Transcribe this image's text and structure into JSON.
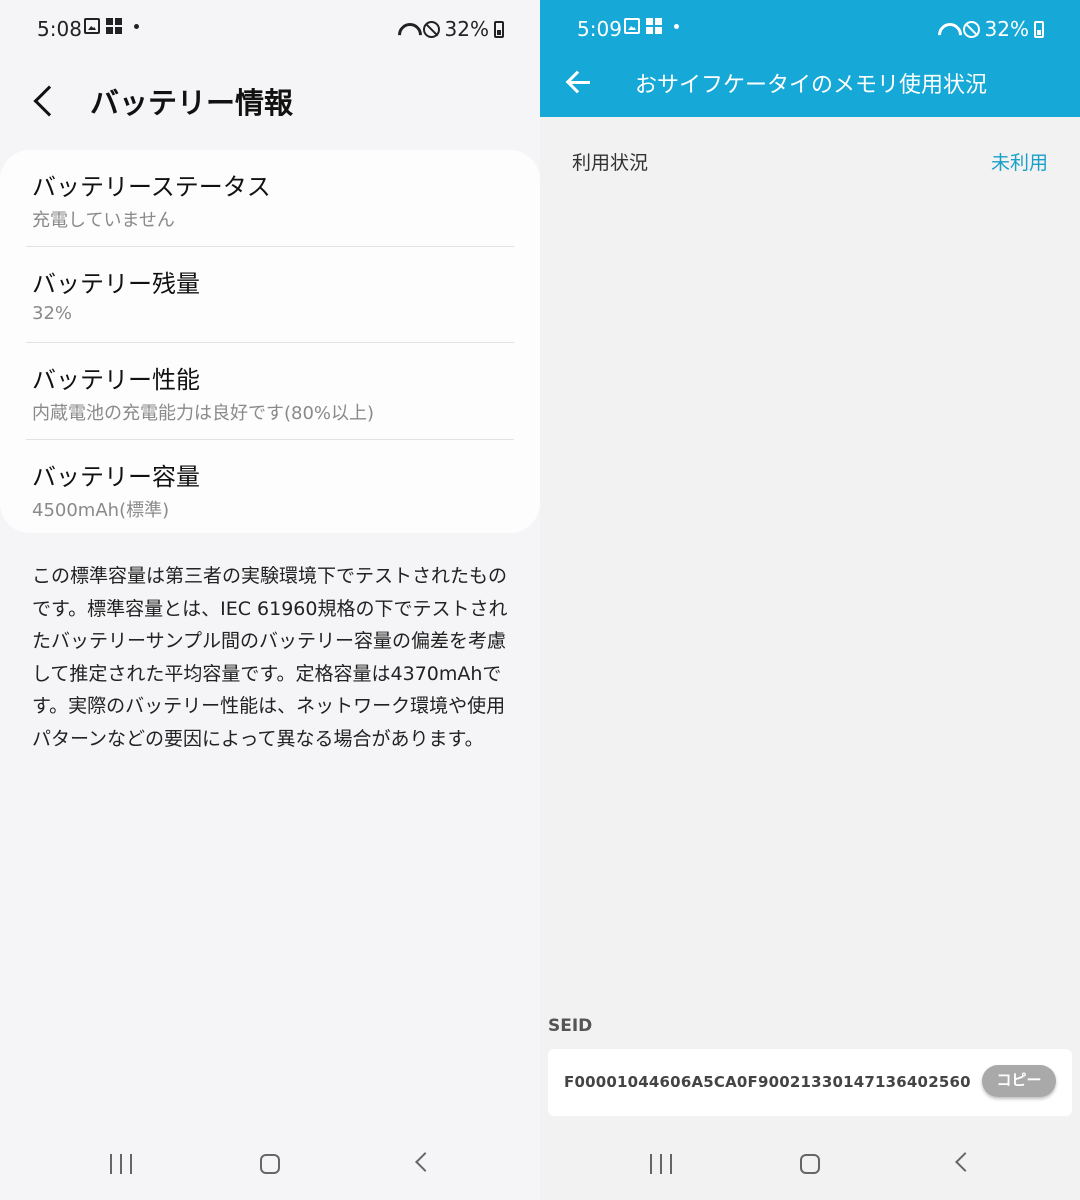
{
  "left": {
    "status": {
      "time": "5:08",
      "battery": "32%"
    },
    "header": {
      "title": "バッテリー情報"
    },
    "rows": [
      {
        "title": "バッテリーステータス",
        "subtitle": "充電していません"
      },
      {
        "title": "バッテリー残量",
        "subtitle": "32%"
      },
      {
        "title": "バッテリー性能",
        "subtitle": "内蔵電池の充電能力は良好です(80%以上)"
      },
      {
        "title": "バッテリー容量",
        "subtitle": "4500mAh(標準)"
      }
    ],
    "note": "この標準容量は第三者の実験環境下でテストされたものです。標準容量とは、IEC 61960規格の下でテストされたバッテリーサンプル間のバッテリー容量の偏差を考慮して推定された平均容量です。定格容量は4370mAhです。実際のバッテリー性能は、ネットワーク環境や使用パターンなどの要因によって異なる場合があります。"
  },
  "right": {
    "status": {
      "time": "5:09",
      "battery": "32%"
    },
    "header": {
      "title": "おサイフケータイのメモリ使用状況"
    },
    "usage": {
      "label": "利用状況",
      "value": "未利用"
    },
    "seid": {
      "label": "SEID",
      "value": "F00001044606A5CA0F90021330147136402560",
      "copy_label": "コピー"
    }
  },
  "colors": {
    "accent": "#16a9d8",
    "link": "#1a9fc9"
  },
  "icons": [
    "image-icon",
    "grid-icon",
    "wifi-icon",
    "dnd-icon",
    "battery-icon",
    "back-chevron-icon",
    "back-arrow-icon",
    "recent-apps-icon",
    "home-icon",
    "nav-back-icon"
  ]
}
